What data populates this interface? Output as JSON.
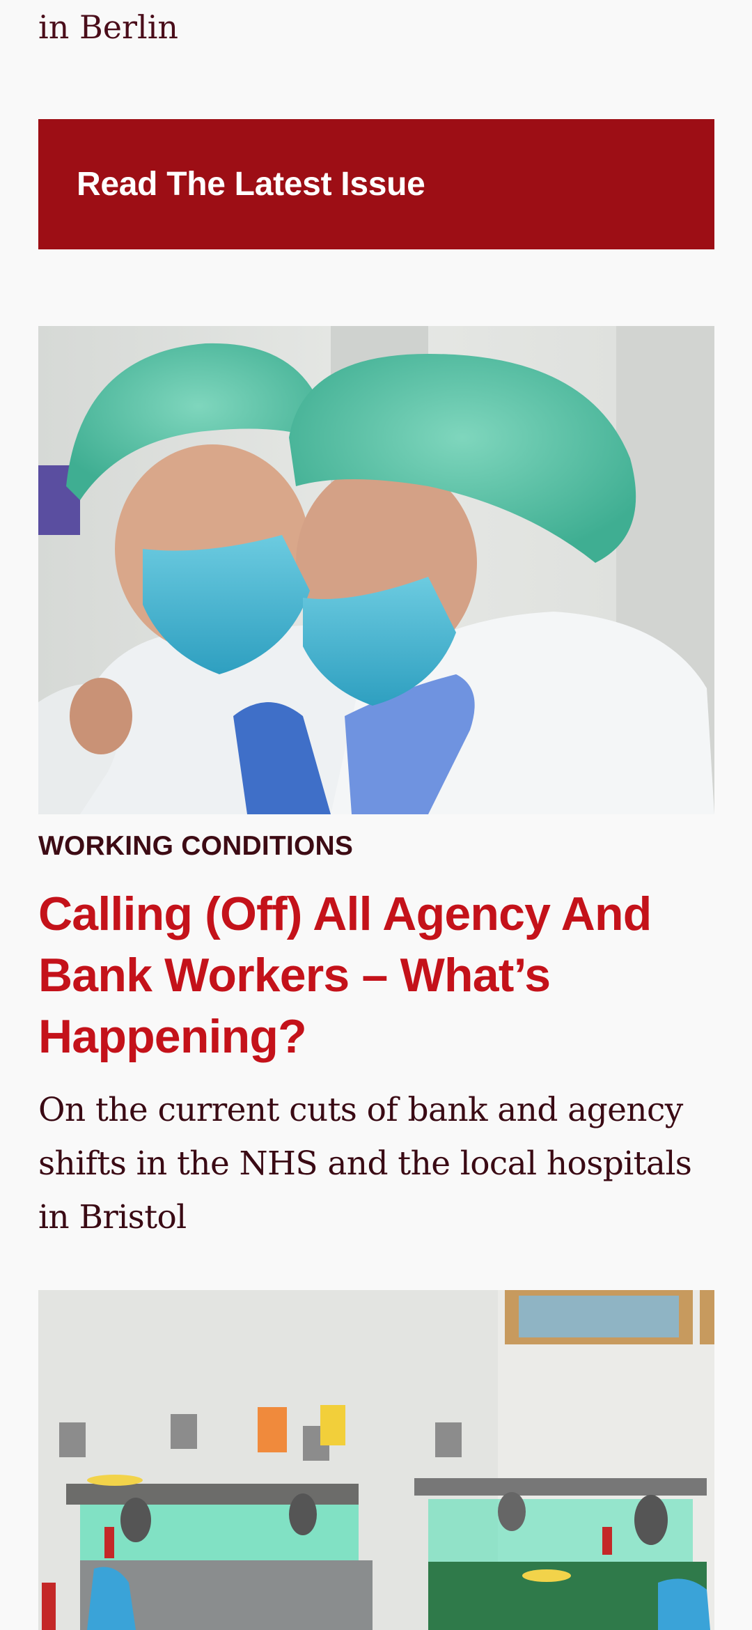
{
  "previous_article": {
    "tail_text": "in Berlin"
  },
  "cta": {
    "label": "Read The Latest Issue",
    "background_color": "#9d0e15"
  },
  "articles": [
    {
      "image": {
        "icon": "photo-two-healthcare-workers-hugging"
      },
      "category": "WORKING CONDITIONS",
      "title": "Calling (Off) All Agency And Bank Workers – What’s Happening?",
      "excerpt": "On the current cuts of bank and agency shifts in the NHS and the local hospitals in Bristol"
    },
    {
      "image": {
        "icon": "photo-hospital-kitchen-food-trolleys"
      }
    }
  ],
  "colors": {
    "background": "#f9f9f9",
    "headline": "#c4121a",
    "category": "#3d0b14",
    "body_text": "#3a0a14"
  }
}
